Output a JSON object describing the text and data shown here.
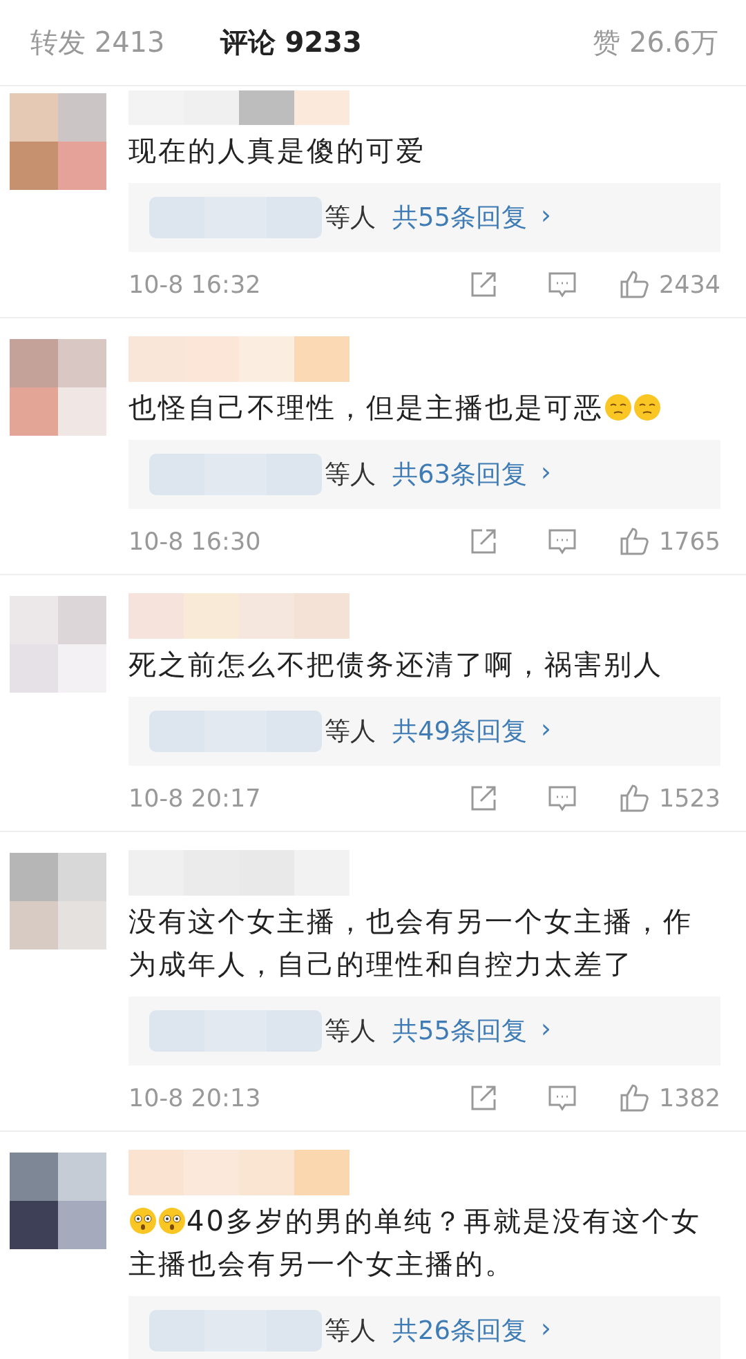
{
  "header": {
    "tabs": [
      {
        "label": "转发 2413",
        "selected": false
      },
      {
        "label": "评论 9233",
        "selected": true
      }
    ],
    "likes": "赞 26.6万"
  },
  "comments": [
    {
      "content": [
        {
          "kind": "text",
          "text": "现在的人真是傻的可爱"
        }
      ],
      "reply_suffix": "等人",
      "reply_link": "共55条回复",
      "reply_arrow": "›",
      "time": "10-8 16:32",
      "likes": "2434"
    },
    {
      "content": [
        {
          "kind": "text",
          "text": "也怪自己不理性，但是主播也是可恶"
        },
        {
          "kind": "shush_emoji"
        },
        {
          "kind": "shush_emoji"
        }
      ],
      "reply_suffix": "等人",
      "reply_link": "共63条回复",
      "reply_arrow": "›",
      "time": "10-8 16:30",
      "likes": "1765"
    },
    {
      "content": [
        {
          "kind": "text",
          "text": "死之前怎么不把债务还清了啊，祸害别人"
        }
      ],
      "reply_suffix": "等人",
      "reply_link": "共49条回复",
      "reply_arrow": "›",
      "time": "10-8 20:17",
      "likes": "1523"
    },
    {
      "content": [
        {
          "kind": "text",
          "text": "没有这个女主播，也会有另一个女主播，作为成年人，自己的理性和自控力太差了"
        }
      ],
      "reply_suffix": "等人",
      "reply_link": "共55条回复",
      "reply_arrow": "›",
      "time": "10-8 20:13",
      "likes": "1382"
    },
    {
      "content": [
        {
          "kind": "flushed_emoji"
        },
        {
          "kind": "flushed_emoji"
        },
        {
          "kind": "text",
          "text": "40多岁的男的单纯？再就是没有这个女主播也会有另一个女主播的。"
        }
      ],
      "reply_suffix": "等人",
      "reply_link": "共26条回复",
      "reply_arrow": "›"
    }
  ]
}
